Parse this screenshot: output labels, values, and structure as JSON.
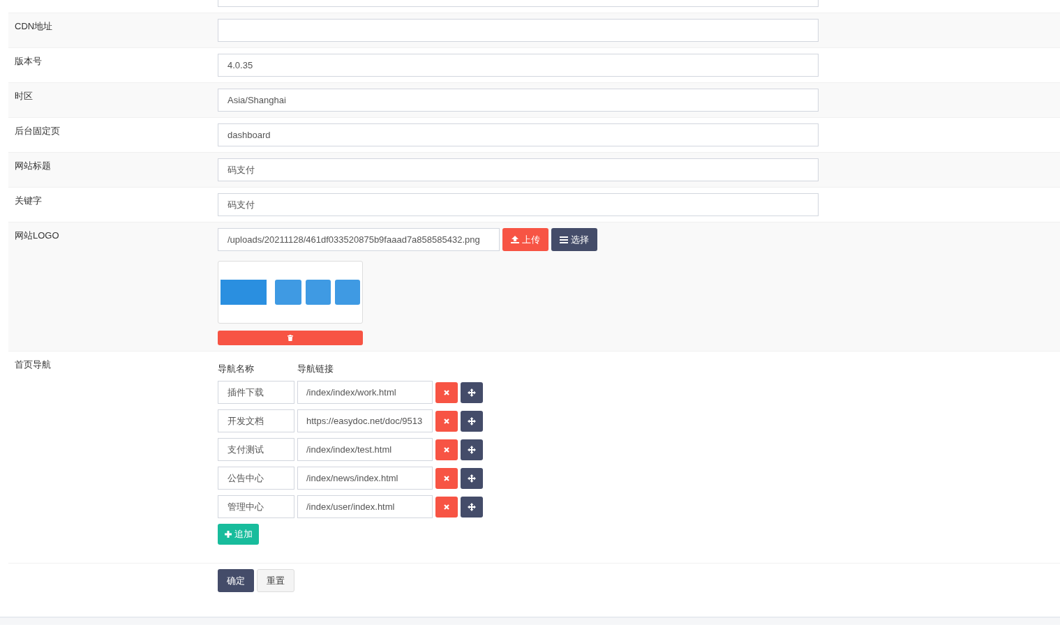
{
  "fields": [
    {
      "kind": "input"
    },
    {
      "kind": "input",
      "label": "CDN地址"
    },
    {
      "kind": "input",
      "label": "版本号",
      "value": "4.0.35"
    },
    {
      "kind": "input",
      "label": "时区",
      "value": "Asia/Shanghai"
    },
    {
      "kind": "input",
      "label": "后台固定页",
      "value": "dashboard"
    },
    {
      "kind": "input",
      "label": "网站标题",
      "value": "码支付"
    },
    {
      "kind": "input",
      "label": "关键字",
      "value": "码支付"
    },
    {
      "kind": "image",
      "label": "网站LOGO",
      "value": "/uploads/20211128/461df033520875b9faaad7a858585432.png",
      "upload": "上传",
      "choose": "选择"
    },
    {
      "kind": "nav",
      "label": "首页导航",
      "columns": [
        "导航名称",
        "导航链接"
      ],
      "rows": [
        {
          "name": "插件下载",
          "link": "/index/index/work.html"
        },
        {
          "name": "开发文档",
          "link": "https://easydoc.net/doc/9513"
        },
        {
          "name": "支付测试",
          "link": "/index/index/test.html"
        },
        {
          "name": "公告中心",
          "link": "/index/news/index.html"
        },
        {
          "name": "管理中心",
          "link": "/index/user/index.html"
        }
      ],
      "add": "追加"
    }
  ],
  "buttons": [
    {
      "kind": "primary",
      "label": "确定"
    },
    {
      "kind": "default",
      "label": "重置"
    }
  ]
}
